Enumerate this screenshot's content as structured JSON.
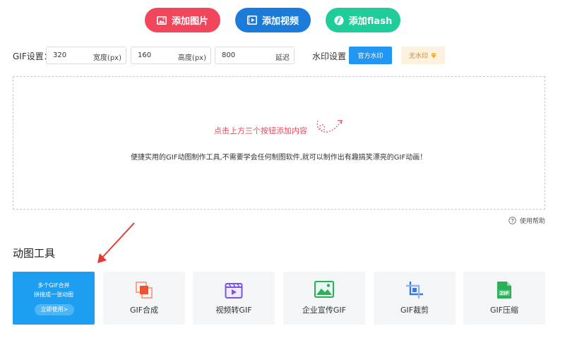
{
  "top_buttons": {
    "add_image": "添加图片",
    "add_video": "添加视频",
    "add_flash": "添加flash"
  },
  "gif_settings": {
    "label": "GIF设置：",
    "width_value": "320",
    "width_unit": "宽度(px)",
    "height_value": "160",
    "height_unit": "高度(px)",
    "delay_value": "800",
    "delay_unit": "延迟"
  },
  "watermark": {
    "label": "水印设置",
    "official": "官方水印",
    "none": "无水印"
  },
  "drop_zone": {
    "hint": "点击上方三个按钮添加内容",
    "description": "便捷实用的GIF动图制作工具,不需要学会任何制图软件,就可以制作出有趣搞笑漂亮的GIF动画！"
  },
  "help": "使用帮助",
  "tools_section": {
    "title": "动图工具",
    "promo": {
      "line1": "多个GIF合并",
      "line2": "拼接成一张动图",
      "cta": "立即使用>"
    },
    "items": [
      {
        "label": "GIF合成",
        "icon": "gif-merge-icon"
      },
      {
        "label": "视频转GIF",
        "icon": "video-to-gif-icon"
      },
      {
        "label": "企业宣传GIF",
        "icon": "image-icon"
      },
      {
        "label": "GIF裁剪",
        "icon": "crop-icon"
      },
      {
        "label": "GIF压缩",
        "icon": "zip-icon"
      }
    ]
  },
  "colors": {
    "image_btn": "#f1475d",
    "video_btn": "#1c7bd8",
    "flash_btn": "#1fcc9a",
    "primary_blue": "#2196f3"
  }
}
